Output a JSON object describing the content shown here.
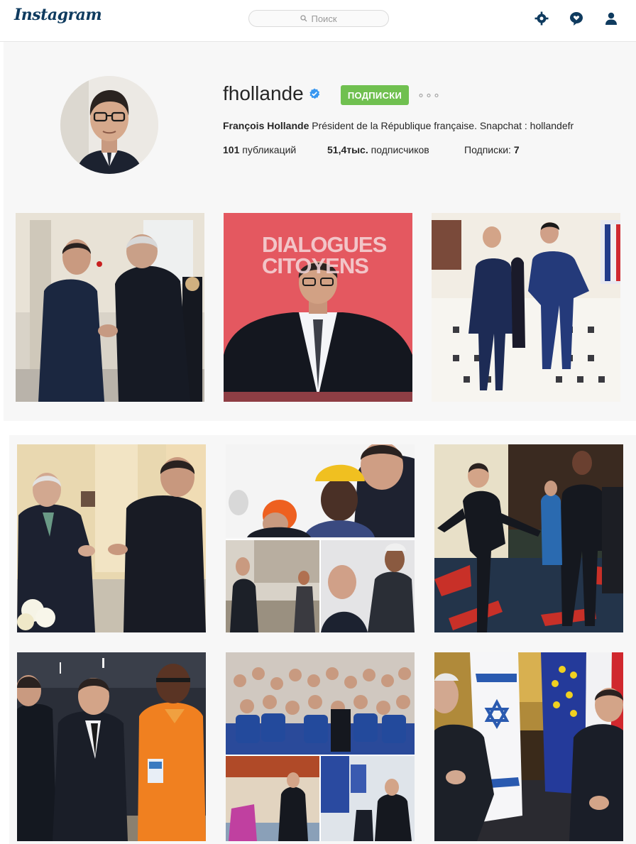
{
  "header": {
    "logo": "Instagram",
    "search_placeholder": "Поиск",
    "icons": [
      "explore-icon",
      "activity-icon",
      "profile-icon"
    ]
  },
  "profile": {
    "username": "fhollande",
    "follow_button": "ПОДПИСКИ",
    "more": "∘∘∘",
    "full_name": "François Hollande",
    "bio": "Président de la République française. Snapchat : hollandefr",
    "posts_count": "101",
    "posts_label": "публикаций",
    "followers_count": "51,4тыс.",
    "followers_label": "подписчиков",
    "following_label": "Подписки:",
    "following_count": "7"
  },
  "posts": [
    {
      "alt_text": ""
    },
    {
      "overlay_line1": "DIALOGUES",
      "overlay_line2": "CITOYENS"
    },
    {
      "alt_text": ""
    },
    {
      "alt_text": ""
    },
    {
      "alt_text": ""
    },
    {
      "alt_text": ""
    },
    {
      "alt_text": ""
    },
    {
      "alt_text": ""
    },
    {
      "alt_text": ""
    }
  ],
  "colors": {
    "brand": "#0f3b5f",
    "follow_green": "#70c050",
    "verified_blue": "#3897f0"
  }
}
